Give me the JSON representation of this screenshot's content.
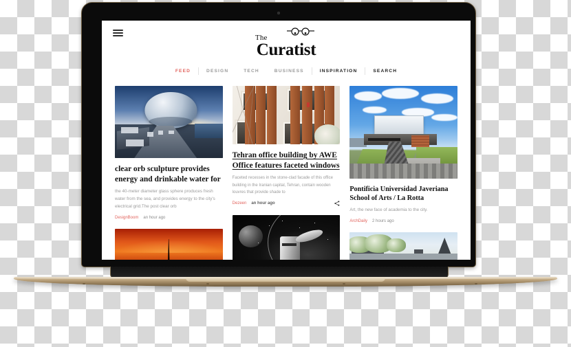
{
  "device": {
    "type": "laptop-mockup",
    "body_color": "#c8b08a",
    "bezel_color": "#0b0b0b"
  },
  "site": {
    "logo": {
      "the": "The",
      "name": "Curatist",
      "glasses_icon": "eyeglasses-icon"
    },
    "menu_icon": "hamburger-menu-icon",
    "accent_color": "#e2655f",
    "nav": [
      {
        "label": "FEED",
        "state": "active"
      },
      {
        "label": "DESIGN",
        "state": "muted"
      },
      {
        "label": "TECH",
        "state": "muted"
      },
      {
        "label": "BUSINESS",
        "state": "muted"
      },
      {
        "label": "INSPIRATION",
        "state": "dark"
      },
      {
        "label": "SEARCH",
        "state": "dark"
      }
    ]
  },
  "feed": {
    "columns": [
      {
        "cards": [
          {
            "image": "glass-orb-sculpture-on-pier",
            "title": "clear orb sculpture provides energy and drinkable water for",
            "excerpt": "the 40-meter diameter glass sphere produces fresh water from the sea, and provides energy to the city's electrical grid.The post clear orb",
            "source": "DesignBoom",
            "time": "an hour ago",
            "share_icon": null
          },
          {
            "image": "orange-sunset-sky-with-spire",
            "title": "",
            "excerpt": "",
            "source": "",
            "time": ""
          }
        ]
      },
      {
        "cards": [
          {
            "image": "stone-facade-with-wooden-louvres",
            "title": "Tehran office building by AWE Office features faceted windows",
            "excerpt": "Faceted recesses in the stone-clad facade of this office building in the Iranian capital, Tehran, contain wooden louvres that provide shade to",
            "source": "Dezeen",
            "time": "an hour ago",
            "share_icon": "share-icon"
          },
          {
            "image": "dark-space-scene-with-spacecraft",
            "title": "",
            "excerpt": "",
            "source": "",
            "time": ""
          }
        ]
      },
      {
        "cards": [
          {
            "image": "modern-university-building-green-roof",
            "title": "Pontificia Universidad Javeriana School of Arts / La Rotta",
            "excerpt": "Art, the new face of academia to the city.",
            "source": "ArchDaily",
            "time": "2 hours ago",
            "share_icon": null
          },
          {
            "image": "trees-and-rooftops-under-sky",
            "title": "",
            "excerpt": "",
            "source": "",
            "time": ""
          }
        ]
      }
    ]
  }
}
